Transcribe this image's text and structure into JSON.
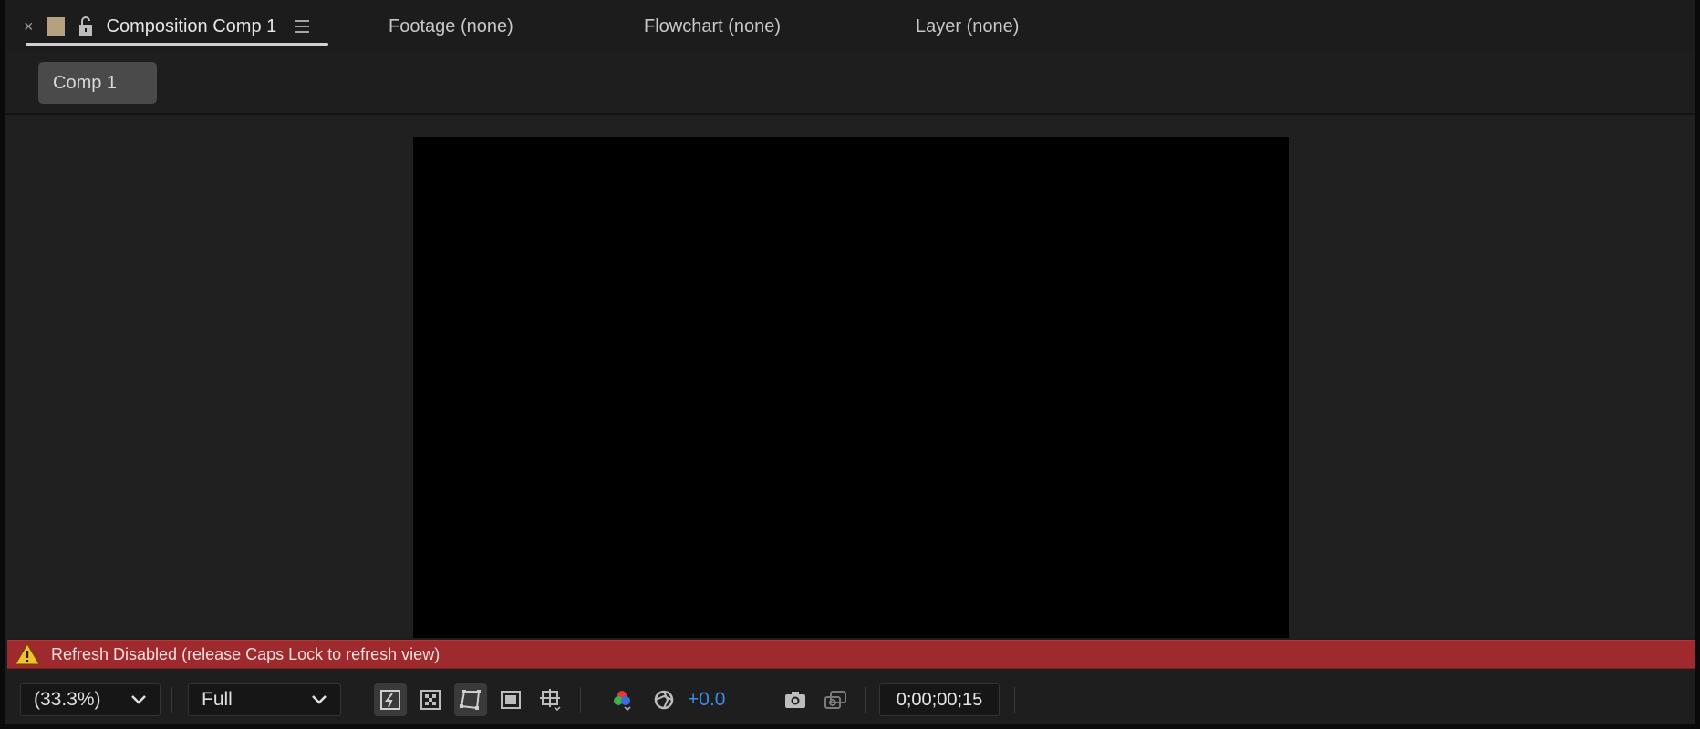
{
  "tabs": {
    "active": {
      "close": "×",
      "label": "Composition Comp 1"
    },
    "others": [
      "Footage (none)",
      "Flowchart (none)",
      "Layer (none)"
    ]
  },
  "breadcrumb": {
    "label": "Comp 1"
  },
  "warning": {
    "text": "Refresh Disabled (release Caps Lock to refresh view)"
  },
  "toolbar": {
    "zoom": "(33.3%)",
    "resolution": "Full",
    "exposure": "+0.0",
    "timecode": "0;00;00;15"
  },
  "colors": {
    "label_swatch": "#b4a17f",
    "warning_bar": "#9e2a2e",
    "exposure_text": "#3d8be8"
  },
  "icons": {
    "tab": [
      "close-icon",
      "label-color-swatch",
      "lock-icon",
      "panel-menu-icon"
    ],
    "toolbar": [
      "chevron-down-icon",
      "fast-previews-icon",
      "transparency-grid-icon",
      "mask-visibility-icon",
      "region-of-interest-icon",
      "grid-guides-icon",
      "show-channel-icon",
      "reset-exposure-icon",
      "snapshot-icon",
      "show-snapshot-icon"
    ]
  }
}
